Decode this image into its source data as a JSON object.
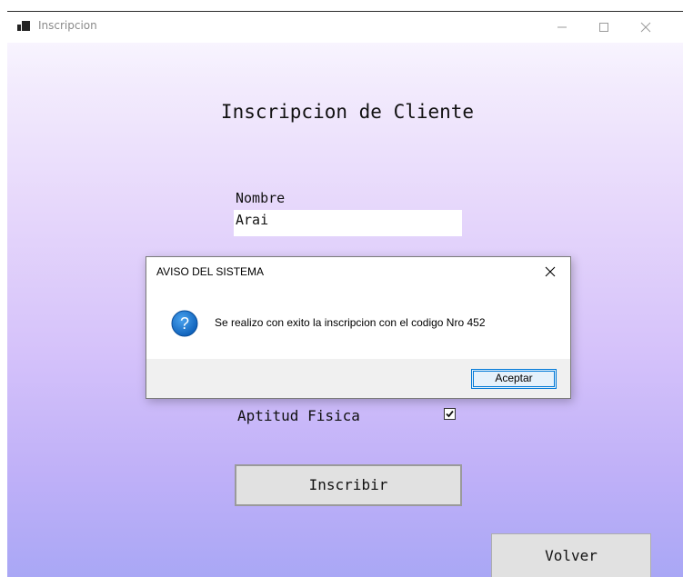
{
  "window": {
    "title": "Inscripcion",
    "icon": "app-window-icon"
  },
  "form": {
    "heading": "Inscripcion de Cliente",
    "nombre_label": "Nombre",
    "nombre_value": "Arai",
    "aptitud_label": "Aptitud Fisica",
    "aptitud_checked": true,
    "inscribir_label": "Inscribir",
    "volver_label": "Volver"
  },
  "dialog": {
    "title": "AVISO DEL SISTEMA",
    "icon": "question-icon",
    "message": "Se realizo con exito la inscripcion con el codigo Nro 452",
    "ok_label": "Aceptar"
  },
  "colors": {
    "gradient_top": "#fcfbff",
    "gradient_bottom": "#a9a7f5",
    "accent": "#0078d7",
    "button_face": "#e1e1e1"
  }
}
